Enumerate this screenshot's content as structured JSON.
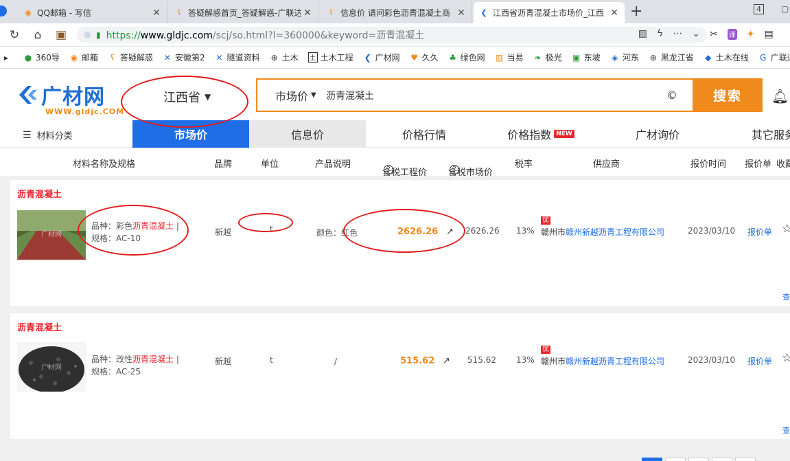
{
  "tabs": [
    {
      "label": "QQ邮箱 - 写信",
      "icon": "mail-icon"
    },
    {
      "label": "答疑解惑首页_答疑解惑-广联达",
      "icon": "question-icon"
    },
    {
      "label": "信息价 请问彩色沥青混凝土商",
      "icon": "question-icon"
    },
    {
      "label": "江西省沥青混凝土市场价_江西",
      "icon": "gldjc-icon"
    }
  ],
  "tab_counter": "4",
  "url": {
    "scheme": "https://",
    "domain": "www.gldjc.com",
    "path": "/scj/so.html?l=360000&keyword=沥青混凝土"
  },
  "bookmarks": [
    "360导",
    "邮箱",
    "答疑解惑",
    "安徽第2",
    "隧道资料",
    "土木",
    "土木工程",
    "广材网",
    "久久",
    "绿色网",
    "当易",
    "极光",
    "东坡",
    "河东",
    "黑龙江省",
    "土木在线",
    "广联达"
  ],
  "site": {
    "logo_text": "广材网",
    "logo_sub": "WWW.gldjc.COM",
    "province": "江西省",
    "search_scope": "市场价",
    "search_value": "沥青混凝土",
    "search_button": "搜索"
  },
  "mainnav": {
    "category": "材料分类",
    "items": [
      "市场价",
      "信息价",
      "价格行情",
      "价格指数",
      "广材询价",
      "其它服务"
    ],
    "new_badge": "NEW"
  },
  "table_header": {
    "name": "材料名称及规格",
    "brand": "品牌",
    "unit": "单位",
    "desc": "产品说明",
    "eng_price": "含税工程价",
    "market_price": "含税市场价",
    "tax": "税率",
    "supplier": "供应商",
    "time": "报价时间",
    "quote": "报价单",
    "fav": "收藏"
  },
  "rows": [
    {
      "title": "沥青混凝土",
      "variety_prefix": "品种：彩色",
      "variety_hl": "沥青混凝土",
      "variety_suffix": " |",
      "spec": "规格：AC-10",
      "brand": "新越",
      "unit": "t",
      "desc": "颜色：红色",
      "eng_price": "2626.26",
      "market_price": "2626.26",
      "tax": "13%",
      "badge": "优",
      "city": "赣州市",
      "supplier": "赣州新越沥青工程有限公司",
      "date": "2023/03/10",
      "quote": "报价单",
      "thumb_label": "广材网",
      "more": "查"
    },
    {
      "title": "沥青混凝土",
      "variety_prefix": "品种：改性",
      "variety_hl": "沥青混凝土",
      "variety_suffix": " |",
      "spec": "规格：AC-25",
      "brand": "新越",
      "unit": "t",
      "desc": "/",
      "eng_price": "515.62",
      "market_price": "515.62",
      "tax": "13%",
      "badge": "优",
      "city": "赣州市",
      "supplier": "赣州新越沥青工程有限公司",
      "date": "2023/03/10",
      "quote": "报价单",
      "thumb_label": "广材网",
      "more": "查"
    }
  ],
  "colors": {
    "brand_blue": "#1f6ee6",
    "accent_orange": "#f08a1c",
    "highlight_red": "#e8262d",
    "annotation_red": "#e31b1b"
  }
}
